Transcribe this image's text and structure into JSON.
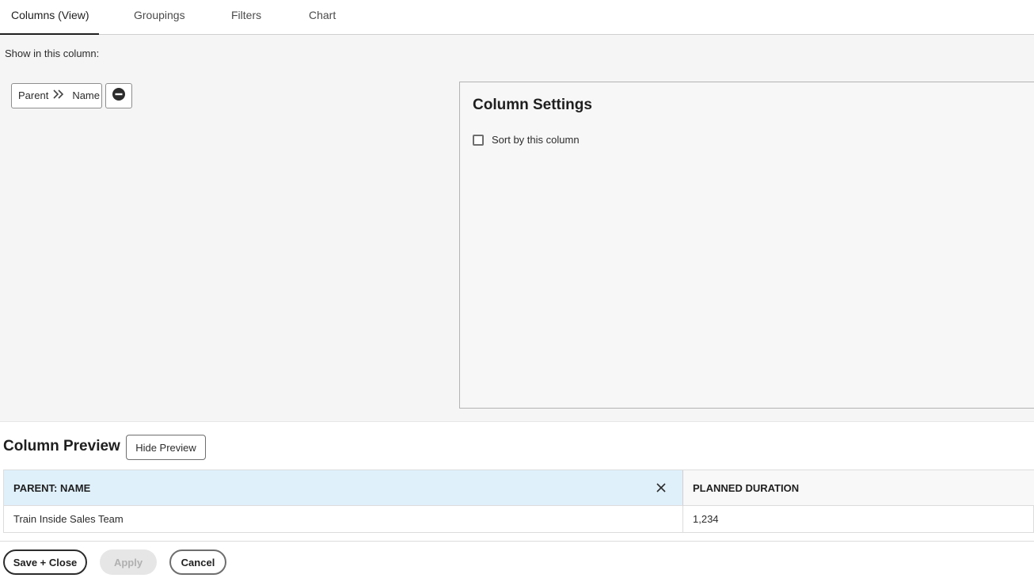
{
  "tabs": [
    {
      "label": "Columns (View)",
      "active": true
    },
    {
      "label": "Groupings",
      "active": false
    },
    {
      "label": "Filters",
      "active": false
    },
    {
      "label": "Chart",
      "active": false
    }
  ],
  "main": {
    "show_label": "Show in this column:",
    "field": {
      "parent": "Parent",
      "name": "Name",
      "separator_icon": "chevron-double-right-icon"
    },
    "remove_icon": "minus-circle-icon"
  },
  "settings": {
    "title": "Column Settings",
    "sort_label": "Sort by this column",
    "sort_checked": false
  },
  "preview": {
    "title": "Column Preview",
    "hide_button": "Hide Preview",
    "columns": [
      "PARENT: NAME",
      "PLANNED DURATION"
    ],
    "rows": [
      [
        "Train Inside Sales Team",
        "1,234"
      ]
    ]
  },
  "footer": {
    "save_close": "Save + Close",
    "apply": "Apply",
    "cancel": "Cancel"
  }
}
